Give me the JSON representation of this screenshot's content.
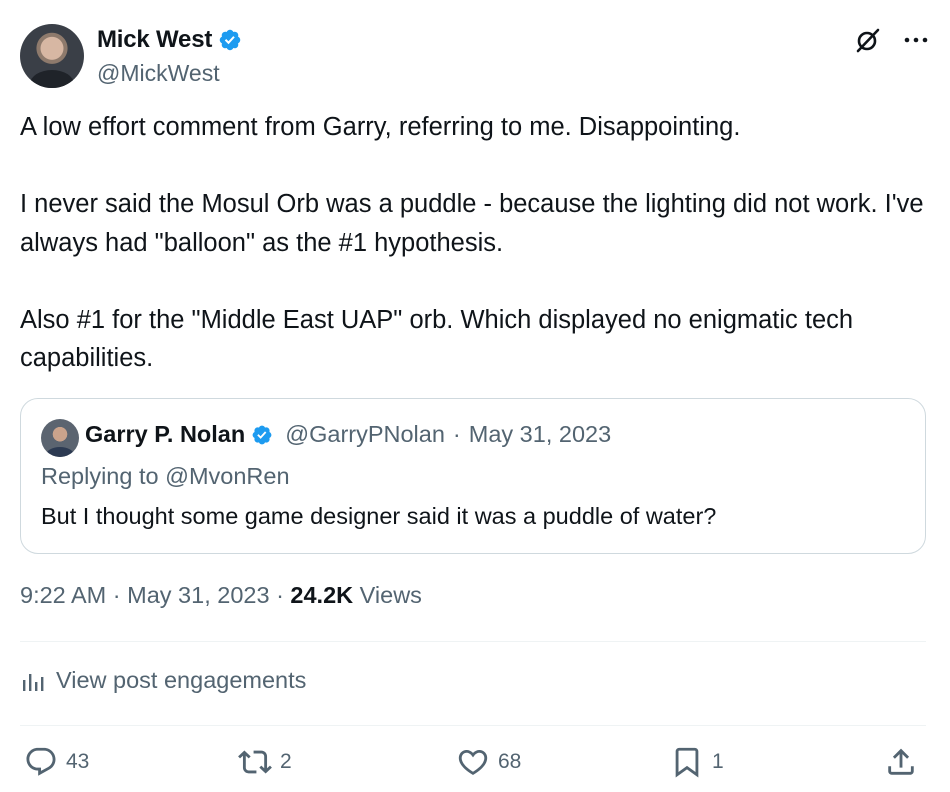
{
  "author": {
    "name": "Mick West",
    "handle": "@MickWest",
    "verified_color": "#1d9bf0"
  },
  "header_icons": [
    "grok-icon",
    "more-icon"
  ],
  "tweet": {
    "paragraphs": [
      "A low effort comment from Garry, referring to me. Disappointing.",
      "I never said the Mosul Orb was a puddle - because the lighting did not work. I've always had \"balloon\" as the #1 hypothesis.",
      "Also #1 for the \"Middle East UAP\" orb. Which displayed no enigmatic tech capabilities."
    ]
  },
  "quoted": {
    "name": "Garry P. Nolan",
    "handle": "@GarryPNolan",
    "separator": "·",
    "date": "May 31, 2023",
    "replying_prefix": "Replying to",
    "replying_to": "@MvonRen",
    "text": "But I thought some game designer said it was a puddle of water?"
  },
  "meta": {
    "time": "9:22 AM",
    "sep1": "·",
    "date": "May 31, 2023",
    "sep2": "·",
    "views_count": "24.2K",
    "views_label": "Views"
  },
  "engagements_label": "View post engagements",
  "actions": {
    "replies": "43",
    "reposts": "2",
    "likes": "68",
    "bookmarks": "1"
  },
  "colors": {
    "text": "#0f1419",
    "secondary": "#536471",
    "border": "#cfd9de",
    "verified": "#1d9bf0"
  }
}
